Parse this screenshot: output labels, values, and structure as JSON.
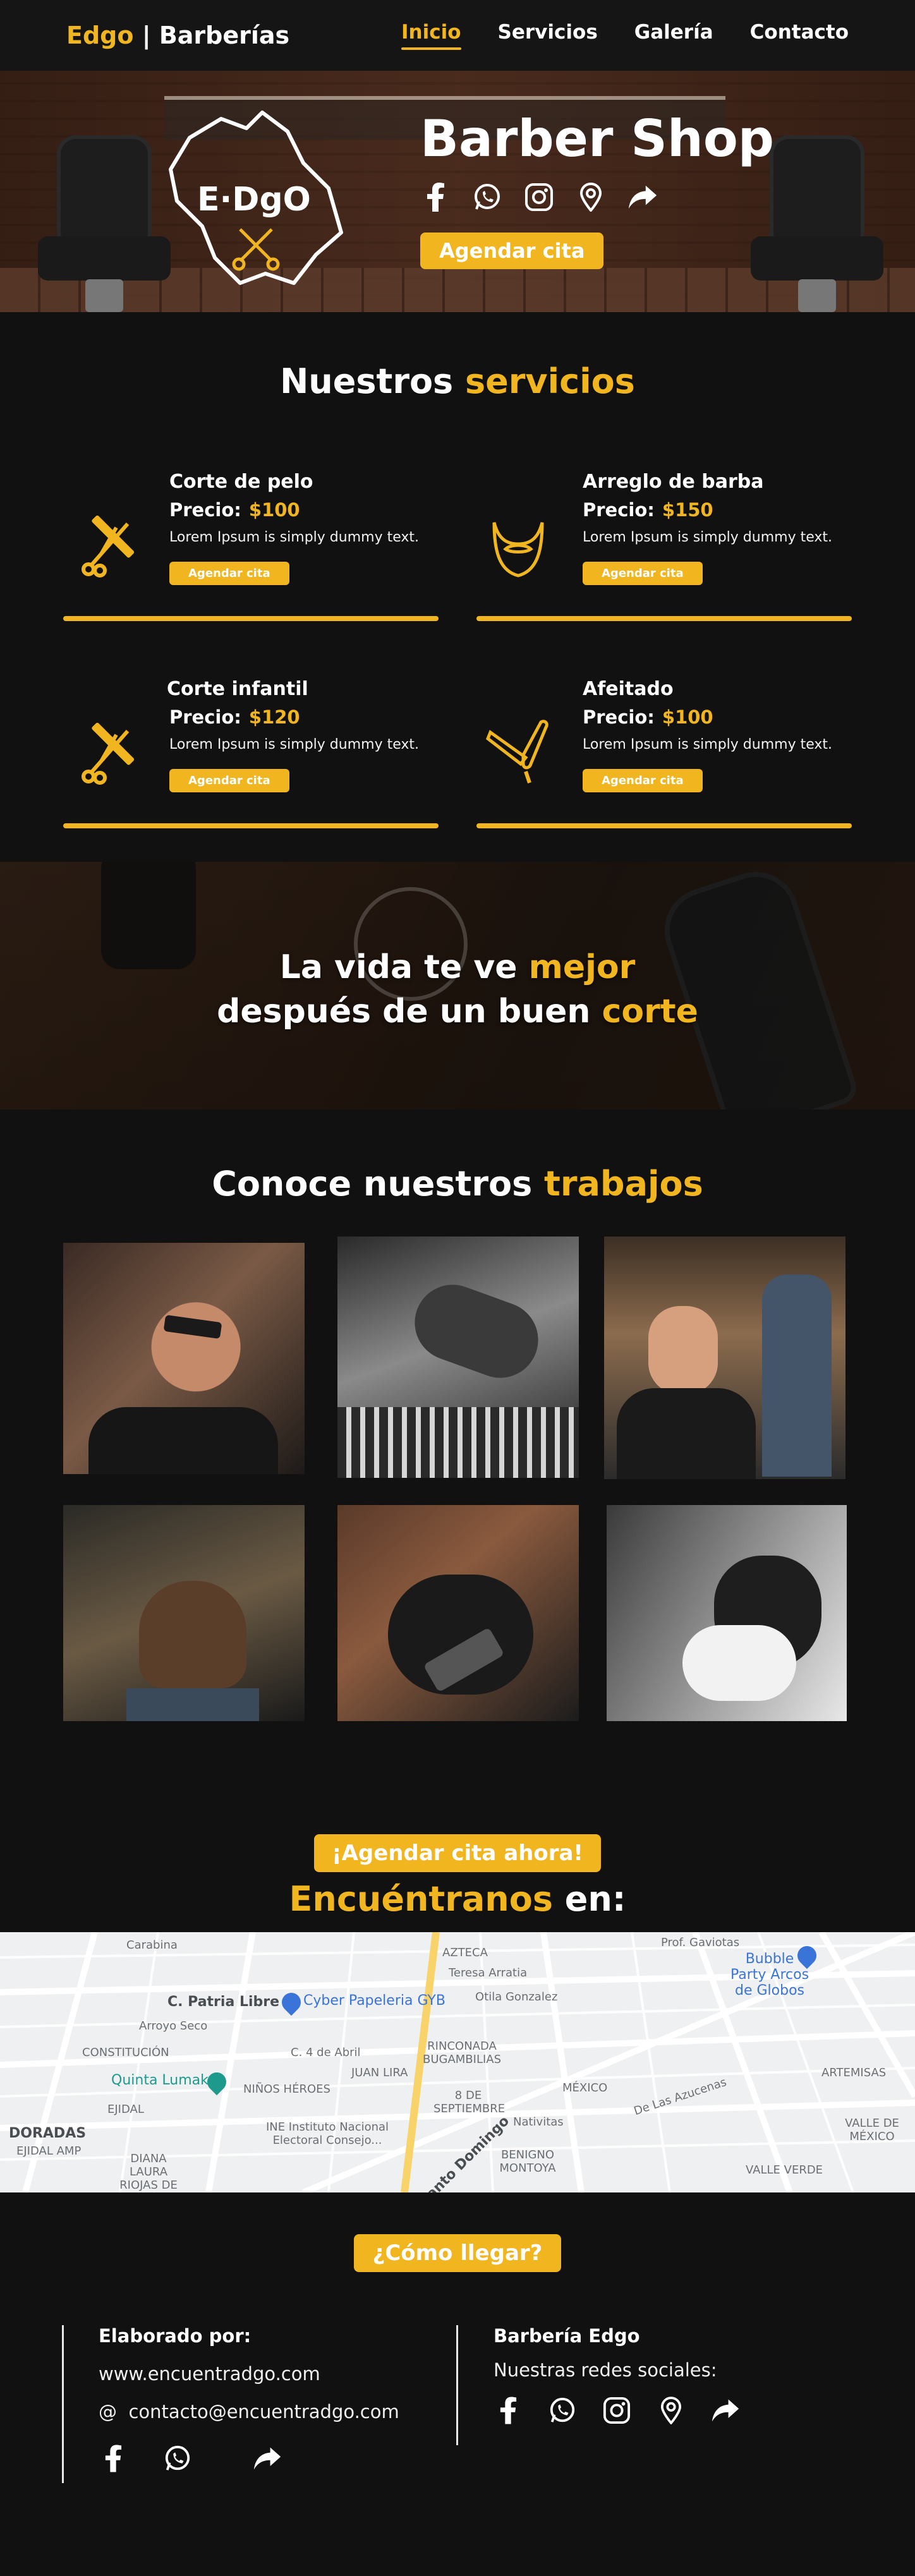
{
  "nav": {
    "brand_accent": "Edgo",
    "brand_sep": " | ",
    "brand_rest": "Barberías",
    "links": [
      "Inicio",
      "Servicios",
      "Galería",
      "Contacto"
    ]
  },
  "hero": {
    "title": "Barber Shop",
    "logo_text": "E·DgO",
    "socials": [
      "facebook-icon",
      "whatsapp-icon",
      "instagram-icon",
      "location-pin-icon",
      "share-arrow-icon"
    ],
    "button": "Agendar cita"
  },
  "services": {
    "title_white": "Nuestros ",
    "title_accent": "servicios",
    "items": [
      {
        "name": "Corte de pelo",
        "price_label": "Precio:",
        "price": "$100",
        "desc": "Lorem Ipsum is simply dummy text.",
        "button": "Agendar cita",
        "icon": "scissors-razor-icon"
      },
      {
        "name": "Arreglo de barba",
        "price_label": "Precio:",
        "price": "$150",
        "desc": "Lorem Ipsum is simply dummy text.",
        "button": "Agendar cita",
        "icon": "beard-icon"
      },
      {
        "name": "Corte infantil",
        "price_label": "Precio:",
        "price": "$120",
        "desc": "Lorem Ipsum is simply dummy text.",
        "button": "Agendar cita",
        "icon": "scissors-razor-icon"
      },
      {
        "name": "Afeitado",
        "price_label": "Precio:",
        "price": "$100",
        "desc": "Lorem Ipsum is simply dummy text.",
        "button": "Agendar cita",
        "icon": "straight-razor-icon"
      }
    ]
  },
  "banner": {
    "line1_white": "La vida te ve ",
    "line1_accent": "mejor",
    "line2_white": "después de un buen ",
    "line2_accent": "corte"
  },
  "gallery": {
    "title_white": "Conoce nuestros ",
    "title_accent": "trabajos",
    "button": "¡Agendar cita ahora!",
    "find_accent": "Encuéntranos",
    "find_white": " en:"
  },
  "map": {
    "labels": [
      "Carabina",
      "C. Patria Libre",
      "Cyber Papeleria GYB",
      "Arroyo Seco",
      "CONSTITUCIÓN",
      "Quinta Lumak",
      "NIÑOS HÉROES",
      "EJIDAL",
      "DORADAS",
      "EJIDAL AMP",
      "DIANA LAURA RIOJAS DE COLOSIO",
      "INE Instituto Nacional Electoral Consejo...",
      "RINCONADA BUGAMBILIAS",
      "C. 4 de Abril",
      "JUAN LIRA",
      "8 DE SEPTIEMBRE",
      "Santo Domingo",
      "BENIGNO MONTOYA",
      "MÉXICO",
      "Bubble Party Arcos de Globos",
      "ARTEMISAS",
      "VALLE DE MÉXICO",
      "VALLE VERDE",
      "Prof. Gaviotas",
      "AZTECA",
      "Teresa Arratia",
      "Otila Gonzalez",
      "Nativitas",
      "De Las Azucenas"
    ]
  },
  "footer": {
    "cta": "¿Cómo llegar?",
    "left_head": "Elaborado por:",
    "left_site": "www.encuentradgo.com",
    "left_email_icon": "@",
    "left_email": "contacto@encuentradgo.com",
    "left_socials": [
      "facebook-icon",
      "whatsapp-icon",
      "share-arrow-icon"
    ],
    "right_head": "Barbería Edgo",
    "right_text": "Nuestras redes sociales:",
    "right_socials": [
      "facebook-icon",
      "whatsapp-icon",
      "instagram-icon",
      "location-pin-icon",
      "share-arrow-icon"
    ]
  },
  "colors": {
    "accent": "#f1b61f",
    "background": "#111111"
  }
}
